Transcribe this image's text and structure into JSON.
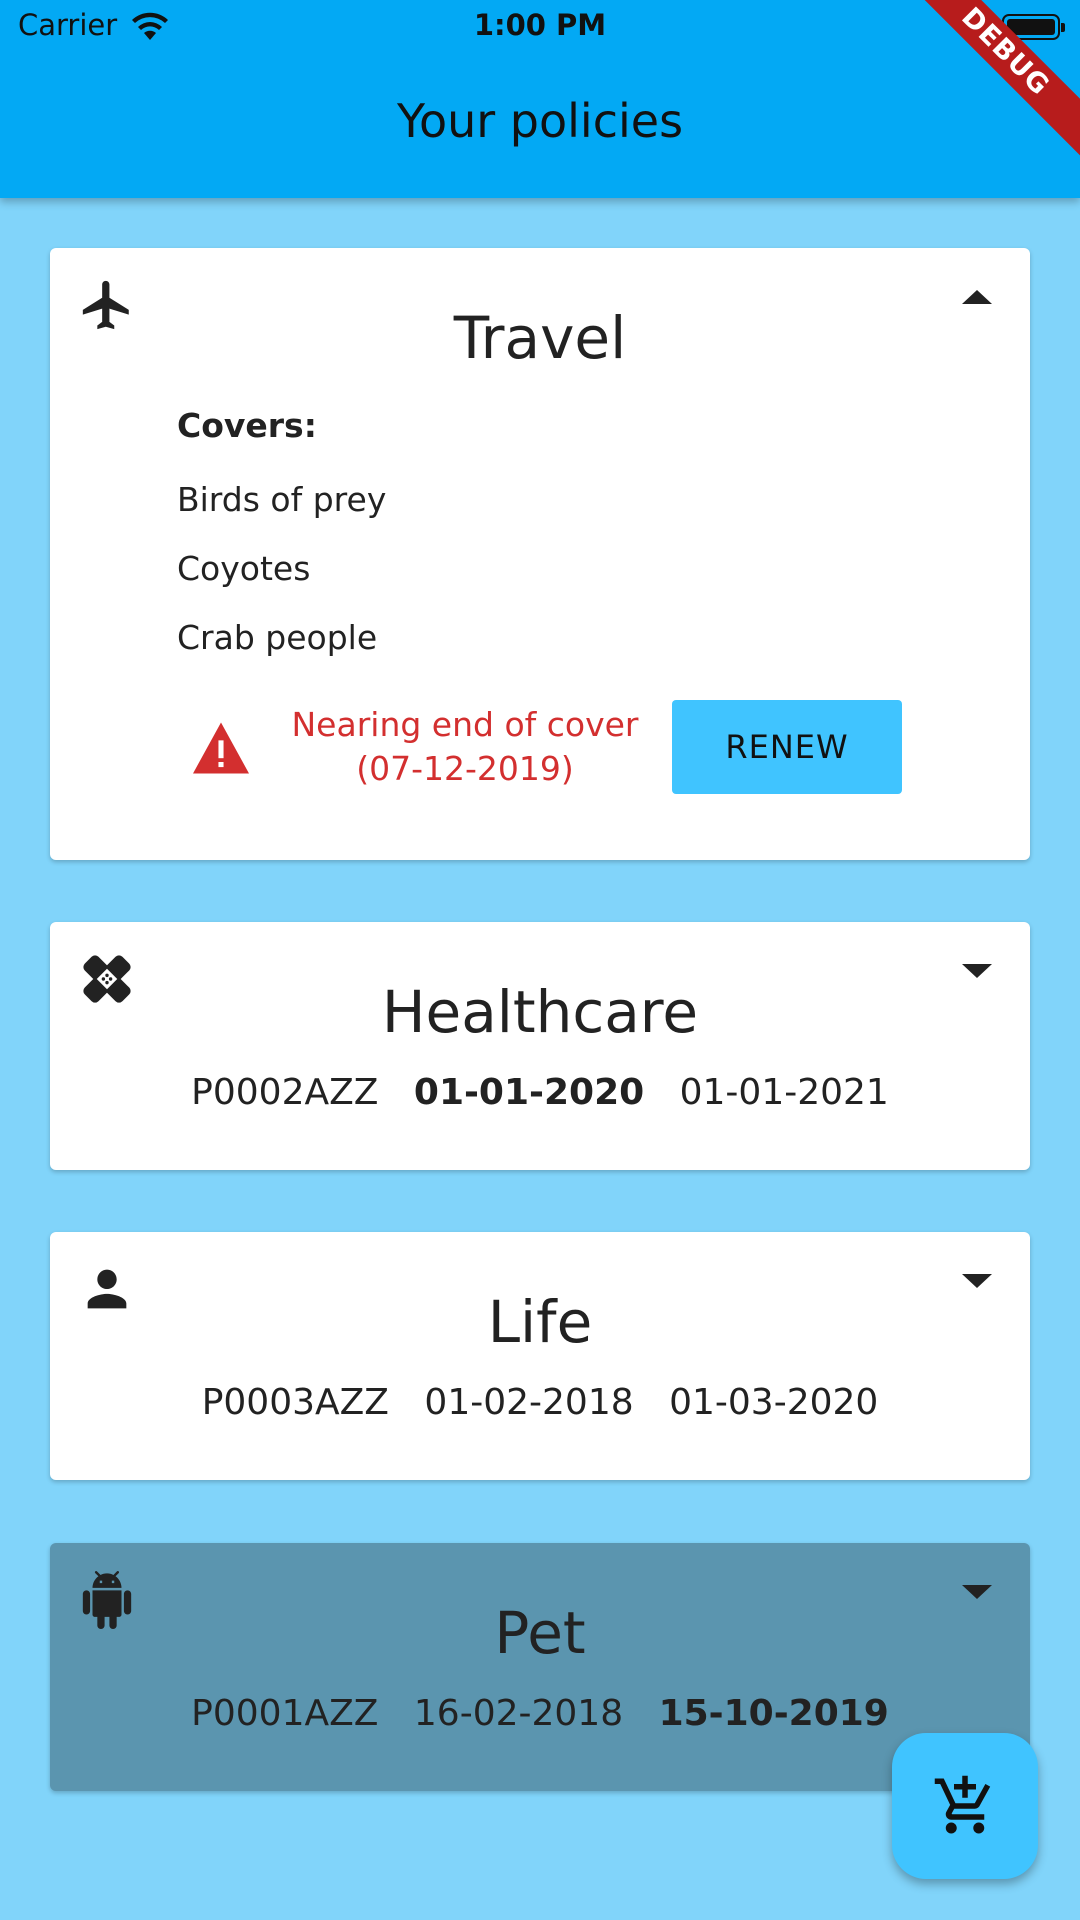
{
  "status_bar": {
    "carrier": "Carrier",
    "time": "1:00 PM"
  },
  "app_bar": {
    "title": "Your policies"
  },
  "debug_banner": "DEBUG",
  "policies": [
    {
      "name": "Travel",
      "icon": "airplane-icon",
      "expanded": true,
      "covers_heading": "Covers:",
      "covers": [
        "Birds of prey",
        "Coyotes",
        "Crab people"
      ],
      "warning_line1": "Nearing end of cover",
      "warning_line2": "(07-12-2019)",
      "renew_label": "RENEW"
    },
    {
      "name": "Healthcare",
      "icon": "bandage-icon",
      "expanded": false,
      "policy_id": "P0002AZZ",
      "start_date": "01-01-2020",
      "end_date": "01-01-2021"
    },
    {
      "name": "Life",
      "icon": "person-icon",
      "expanded": false,
      "policy_id": "P0003AZZ",
      "start_date": "01-02-2018",
      "end_date": "01-03-2020"
    },
    {
      "name": "Pet",
      "icon": "android-icon",
      "expanded": false,
      "selected": true,
      "policy_id": "P0001AZZ",
      "start_date": "16-02-2018",
      "end_date": "15-10-2019"
    }
  ],
  "fab": {
    "icon": "add-shopping-cart-icon"
  },
  "colors": {
    "app_bar": "#03A9F4",
    "background": "#81D4FA",
    "selected_card": "#5B95AF",
    "warning": "#D32F2F",
    "button": "#40C4FF",
    "debug_banner": "#B71C1C"
  }
}
